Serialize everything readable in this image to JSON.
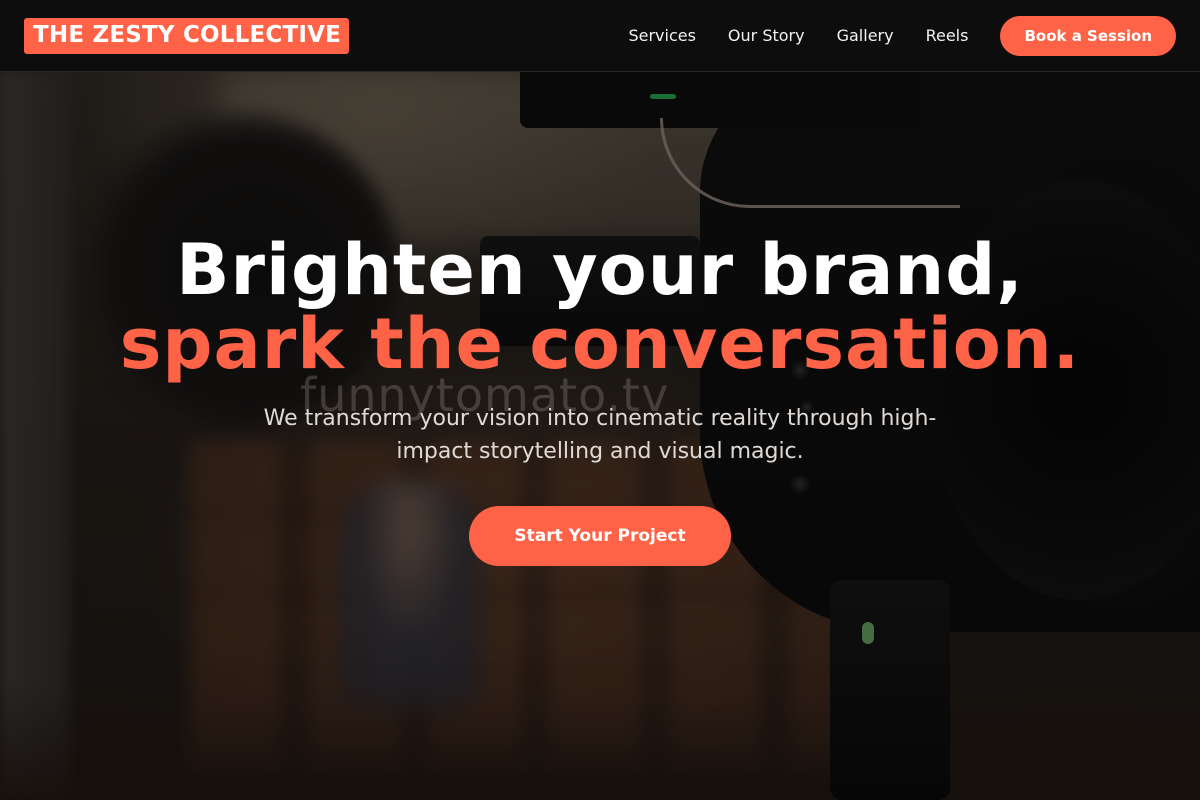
{
  "brand": {
    "name": "THE ZESTY COLLECTIVE",
    "accent_color": "#ff6347"
  },
  "nav": {
    "links": [
      {
        "label": "Services"
      },
      {
        "label": "Our Story"
      },
      {
        "label": "Gallery"
      },
      {
        "label": "Reels"
      }
    ],
    "cta_label": "Book a Session"
  },
  "hero": {
    "headline_line1": "Brighten your brand,",
    "headline_line2": "spark the conversation.",
    "subtitle": "We transform your vision into cinematic reality through high-impact storytelling and visual magic.",
    "cta_label": "Start Your Project",
    "background": "blurred studio scene with a cinema camera in the foreground"
  },
  "watermark": {
    "text": "funnytomato.tv"
  }
}
